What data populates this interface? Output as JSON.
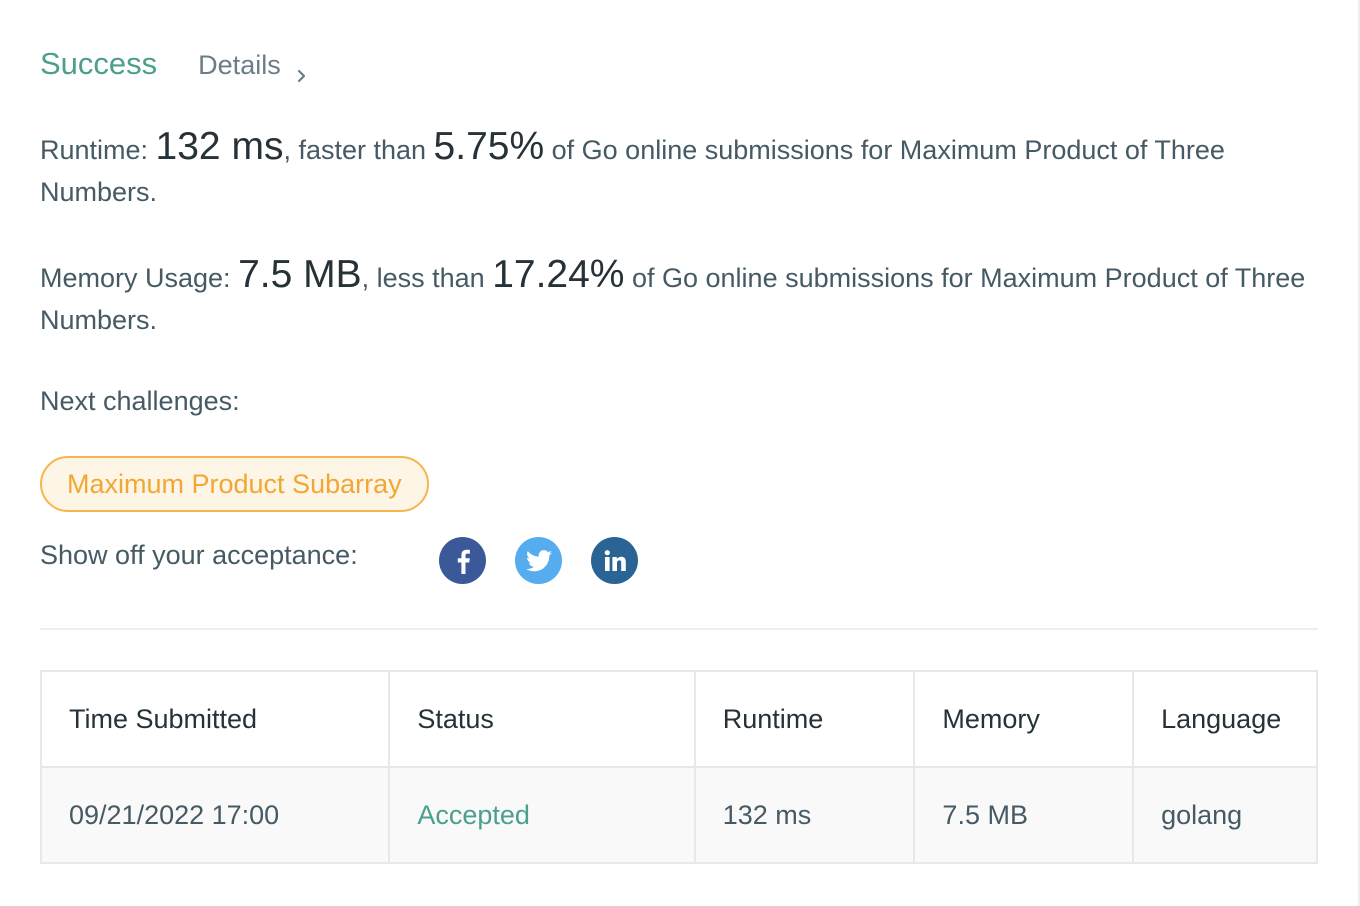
{
  "header": {
    "status": "Success",
    "details_label": "Details",
    "details_icon": "chevron-right-icon"
  },
  "runtime": {
    "label": "Runtime: ",
    "value": "132 ms",
    "mid": ", faster than ",
    "percent": "5.75%",
    "suffix": " of Go online submissions for Maximum Product of Three Numbers."
  },
  "memory": {
    "label": "Memory Usage: ",
    "value": "7.5 MB",
    "mid": ", less than ",
    "percent": "17.24%",
    "suffix": " of Go online submissions for Maximum Product of Three Numbers."
  },
  "next_challenges": {
    "label": "Next challenges:",
    "items": [
      "Maximum Product Subarray"
    ]
  },
  "share": {
    "label": "Show off your acceptance:",
    "icons": [
      "facebook-icon",
      "twitter-icon",
      "linkedin-icon"
    ]
  },
  "submissions": {
    "headers": [
      "Time Submitted",
      "Status",
      "Runtime",
      "Memory",
      "Language"
    ],
    "rows": [
      [
        "09/21/2022 17:00",
        "Accepted",
        "132 ms",
        "7.5 MB",
        "golang"
      ]
    ]
  },
  "colors": {
    "success": "#4aa08d",
    "challenge_tag": "#f2a734",
    "facebook": "#3b5998",
    "twitter": "#55acee",
    "linkedin": "#2a6495"
  }
}
